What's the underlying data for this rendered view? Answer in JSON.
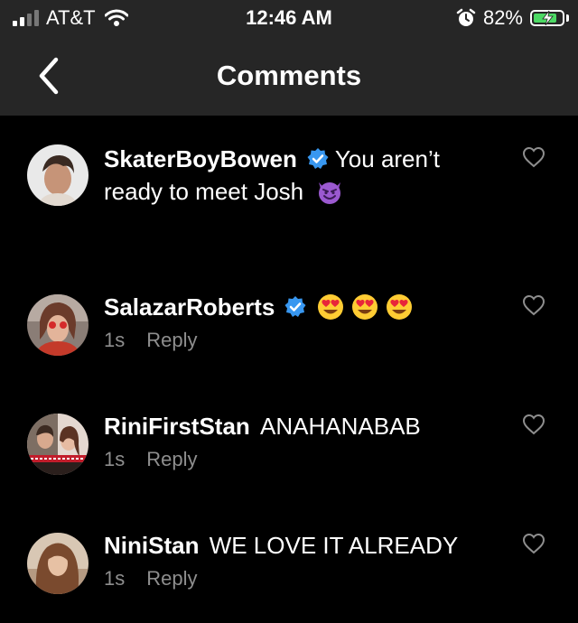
{
  "status_bar": {
    "carrier": "AT&T",
    "time": "12:46 AM",
    "battery_percent": "82%",
    "battery_level": 0.82,
    "charging": true
  },
  "nav": {
    "title": "Comments",
    "back_icon": "chevron-left-icon"
  },
  "comments": [
    {
      "username": "SkaterBoyBowen",
      "verified": true,
      "text_first_line": "You aren’t",
      "text_second_line": "ready to meet Josh",
      "emoji": "smiling-devil"
    },
    {
      "username": "SalazarRoberts",
      "verified": true,
      "emoji": [
        "heart-eyes",
        "heart-eyes",
        "heart-eyes"
      ],
      "time": "1s",
      "reply_label": "Reply"
    },
    {
      "username": "RiniFirstStan",
      "verified": false,
      "text": "ANAHANABAB",
      "time": "1s",
      "reply_label": "Reply"
    },
    {
      "username": "NiniStan",
      "verified": false,
      "text": "WE LOVE IT ALREADY",
      "time": "1s",
      "reply_label": "Reply"
    }
  ],
  "colors": {
    "bar_background": "#262626",
    "background": "#000000",
    "meta_text": "#8e8e8e",
    "verified_blue": "#3897f0",
    "battery_green": "#4cd964"
  }
}
